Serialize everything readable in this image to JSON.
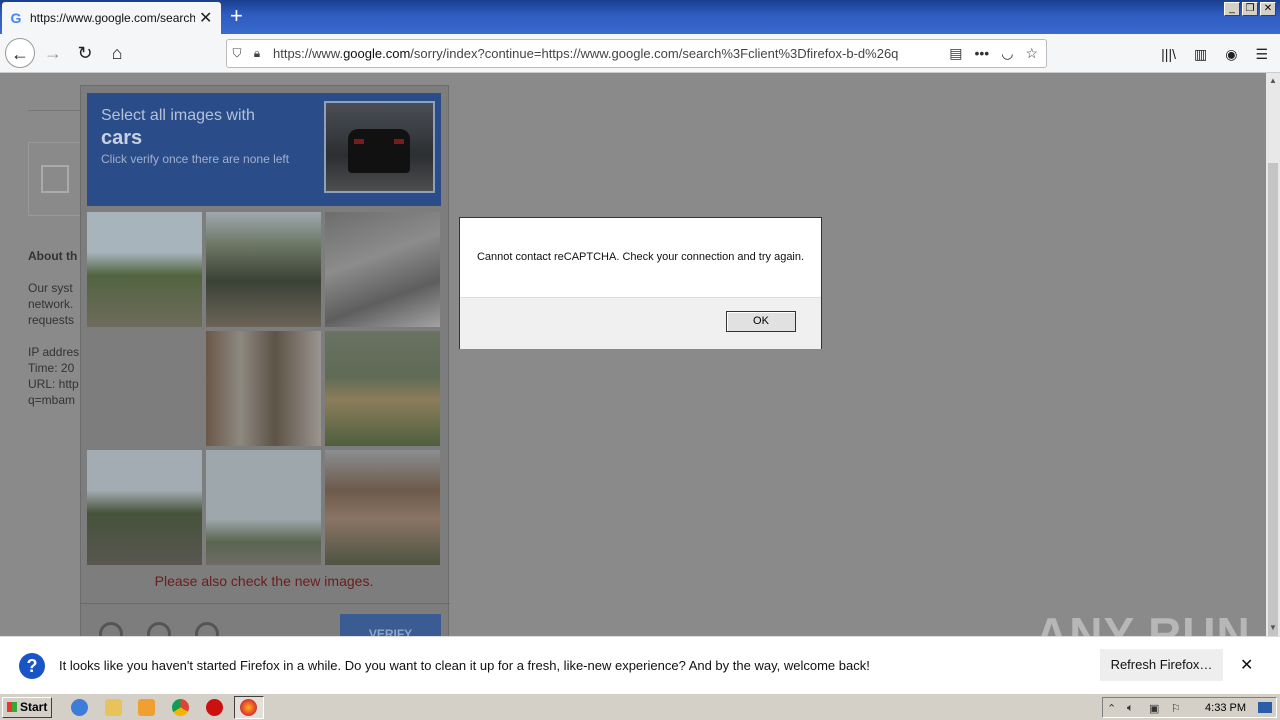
{
  "browser": {
    "tab_title": "https://www.google.com/search?c",
    "new_tab_symbol": "+",
    "url_prefix": "https://www.",
    "url_domain": "google.com",
    "url_rest": "/sorry/index?continue=https://www.google.com/search%3Fclient%3Dfirefox-b-d%26q"
  },
  "page_bg": {
    "about_heading": "About th",
    "para_lines": [
      "Our syst",
      "network.",
      "requests"
    ],
    "info_lines": [
      "IP addres",
      "Time: 20",
      "URL: http",
      "q=mbam"
    ]
  },
  "captcha": {
    "instruction": "Select all images with",
    "keyword": "cars",
    "hint": "Click verify once there are none left",
    "also_check": "Please also check the new images.",
    "verify_label": "VERIFY"
  },
  "dialog": {
    "message": "Cannot contact reCAPTCHA. Check your connection and try again.",
    "ok_label": "OK"
  },
  "notification": {
    "message": "It looks like you haven't started Firefox in a while. Do you want to clean it up for a fresh, like-new experience? And by the way, welcome back!",
    "refresh_label": "Refresh Firefox…",
    "close_symbol": "✕"
  },
  "watermark": "ANY RUN",
  "taskbar": {
    "start_label": "Start",
    "time": "4:33 PM"
  }
}
